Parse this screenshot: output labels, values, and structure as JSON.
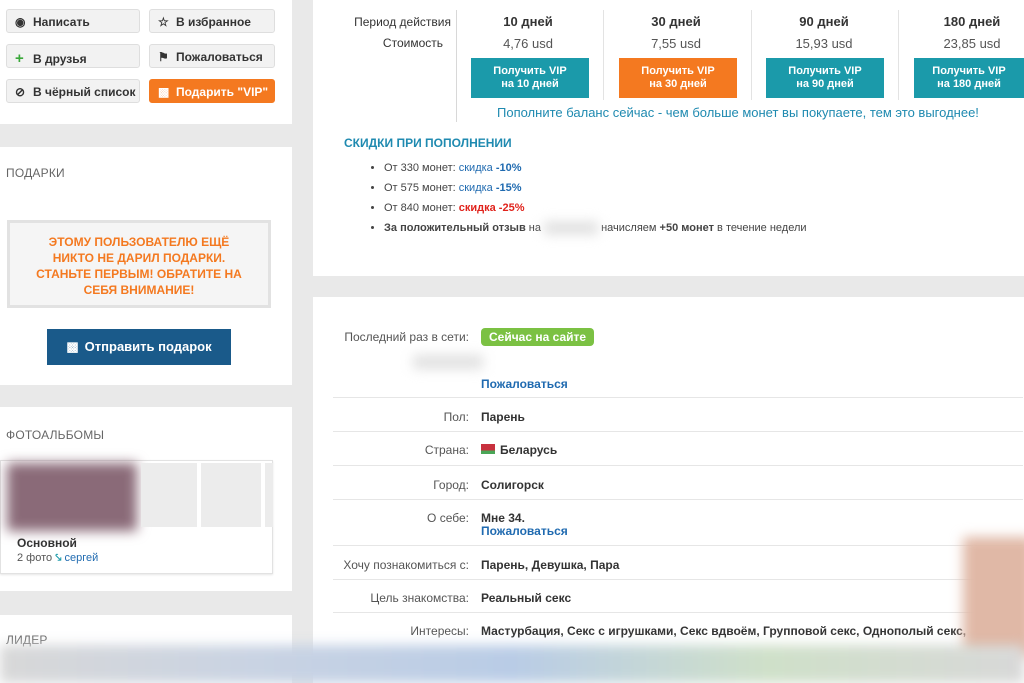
{
  "left_actions": {
    "write": "Написать",
    "favorite": "В избранное",
    "friends": "В друзья",
    "report": "Пожаловаться",
    "blacklist": "В чёрный список",
    "gift_vip": "Подарить \"VIP\""
  },
  "gifts": {
    "title": "ПОДАРКИ",
    "notice": "ЭТОМУ ПОЛЬЗОВАТЕЛЮ ЕЩЁ НИКТО НЕ ДАРИЛ ПОДАРКИ. СТАНЬТЕ ПЕРВЫМ! ОБРАТИТЕ НА СЕБЯ ВНИМАНИЕ!",
    "send_button": "Отправить подарок"
  },
  "albums": {
    "title": "ФОТОАЛЬБОМЫ",
    "album_name": "Основной",
    "count": "2 фото",
    "owner": "сергей"
  },
  "leader": {
    "title": "ЛИДЕР"
  },
  "vip": {
    "period_label": "Период действия",
    "cost_label": "Стоимость",
    "plans": [
      {
        "days": "10 дней",
        "price": "4,76 usd",
        "btn_line1": "Получить VIP",
        "btn_line2": "на 10 дней",
        "color": "#1b9aaa"
      },
      {
        "days": "30 дней",
        "price": "7,55 usd",
        "btn_line1": "Получить VIP",
        "btn_line2": "на 30 дней",
        "color": "#f47920"
      },
      {
        "days": "90 дней",
        "price": "15,93 usd",
        "btn_line1": "Получить VIP",
        "btn_line2": "на 90 дней",
        "color": "#1b9aaa"
      },
      {
        "days": "180 дней",
        "price": "23,85 usd",
        "btn_line1": "Получить VIP",
        "btn_line2": "на 180 дней",
        "color": "#1b9aaa"
      }
    ],
    "topup_link": "Пополните баланс сейчас - чем больше монет вы покупаете, тем это выгоднее!",
    "discounts_title": "СКИДКИ ПРИ ПОПОЛНЕНИИ",
    "discounts": [
      {
        "prefix": "От 330 монет:",
        "word": "скидка",
        "pct": "-10%"
      },
      {
        "prefix": "От 575 монет:",
        "word": "скидка",
        "pct": "-15%"
      },
      {
        "prefix": "От 840 монет:",
        "word": "скидка",
        "pct": "-25%"
      }
    ],
    "review_bold": "За положительный отзыв",
    "review_on": "на",
    "review_mid": "начисляем",
    "review_coins": "+50 монет",
    "review_tail": "в течение недели"
  },
  "profile": {
    "last_seen_label": "Последний раз в сети:",
    "online_badge": "Сейчас на сайте",
    "report_link": "Пожаловаться",
    "gender_label": "Пол:",
    "gender": "Парень",
    "country_label": "Страна:",
    "country": "Беларусь",
    "city_label": "Город:",
    "city": "Солигорск",
    "about_label": "О себе:",
    "about": "Мне 34.",
    "about_report": "Пожаловаться",
    "seeking_label": "Хочу познакомиться с:",
    "seeking": "Парень, Девушка, Пара",
    "goal_label": "Цель знакомства:",
    "goal": "Реальный секс",
    "interests_label": "Интересы:",
    "interests": "Мастурбация, Секс с игрушками, Секс вдвоём, Групповой секс, Однополый секс,"
  },
  "colors": {
    "accent_orange": "#f47920",
    "teal": "#1b9aaa",
    "link_blue": "#1f6ab0",
    "online_green": "#7bc143",
    "discount_red": "#e0231c",
    "gift_button": "#1a5a8a"
  }
}
